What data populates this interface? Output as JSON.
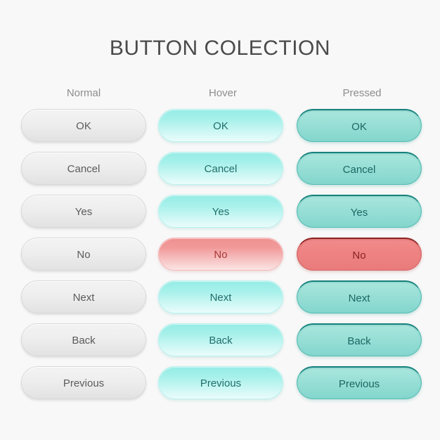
{
  "page": {
    "title": "BUTTON COLECTION",
    "background_color": "#f8f8f8",
    "title_color": "#4a4a4a"
  },
  "columns": [
    {
      "key": "normal",
      "label": "Normal"
    },
    {
      "key": "hover",
      "label": "Hover"
    },
    {
      "key": "pressed",
      "label": "Pressed"
    }
  ],
  "palette": {
    "normal_fill_top": "#f3f3f3",
    "normal_fill_bottom": "#e2e2e2",
    "normal_text": "#5b5b5b",
    "hover_fill_top": "#96ece6",
    "hover_fill_bottom": "#e9fcfb",
    "hover_text": "#1f6f6b",
    "pressed_fill_top": "#a9e6dd",
    "pressed_fill_bottom": "#83d6cd",
    "pressed_border_top": "#17817c",
    "pressed_text": "#1b6763",
    "danger_hover_fill_top": "#ef9090",
    "danger_hover_fill_bottom": "#fbe4e4",
    "danger_hover_text": "#a83838",
    "danger_pressed_fill": "#ef8383",
    "danger_pressed_border_top": "#8d2323",
    "danger_pressed_text": "#8a2222",
    "header_text": "#8d8d8d"
  },
  "rows": [
    {
      "label": "OK",
      "variant": "default"
    },
    {
      "label": "Cancel",
      "variant": "default"
    },
    {
      "label": "Yes",
      "variant": "default"
    },
    {
      "label": "No",
      "variant": "danger"
    },
    {
      "label": "Next",
      "variant": "default"
    },
    {
      "label": "Back",
      "variant": "default"
    },
    {
      "label": "Previous",
      "variant": "default"
    }
  ]
}
